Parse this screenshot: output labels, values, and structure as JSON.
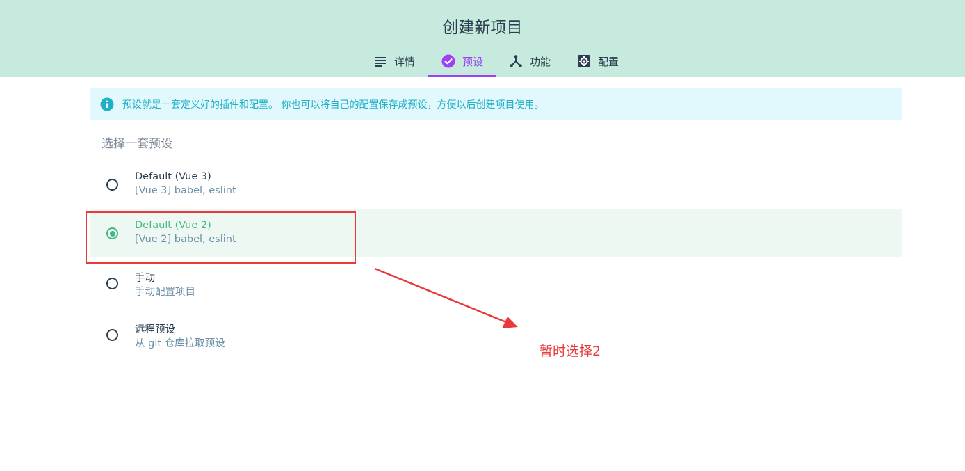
{
  "header": {
    "title": "创建新项目",
    "tabs": [
      {
        "label": "详情",
        "icon": "list-icon",
        "active": false
      },
      {
        "label": "预设",
        "icon": "check-circle-icon",
        "active": true
      },
      {
        "label": "功能",
        "icon": "fork-icon",
        "active": false
      },
      {
        "label": "配置",
        "icon": "gear-icon",
        "active": false
      }
    ]
  },
  "info": {
    "icon": "info-icon",
    "text": "预设就是一套定义好的插件和配置。 你也可以将自己的配置保存成预设，方便以后创建项目使用。"
  },
  "section_title": "选择一套预设",
  "presets": [
    {
      "name": "Default (Vue 3)",
      "description": "[Vue 3] babel, eslint",
      "selected": false
    },
    {
      "name": "Default (Vue 2)",
      "description": "[Vue 2] babel, eslint",
      "selected": true
    },
    {
      "name": "手动",
      "description": "手动配置项目",
      "selected": false
    },
    {
      "name": "远程预设",
      "description": "从 git 仓库拉取预设",
      "selected": false
    }
  ],
  "annotation": {
    "note": "暂时选择2",
    "color": "#e83a3a"
  },
  "colors": {
    "header_bg": "#c6eadd",
    "accent_purple": "#9b42f5",
    "accent_green": "#42b983",
    "info_bg": "#e1f8fc",
    "info_text": "#1fb0c8"
  }
}
